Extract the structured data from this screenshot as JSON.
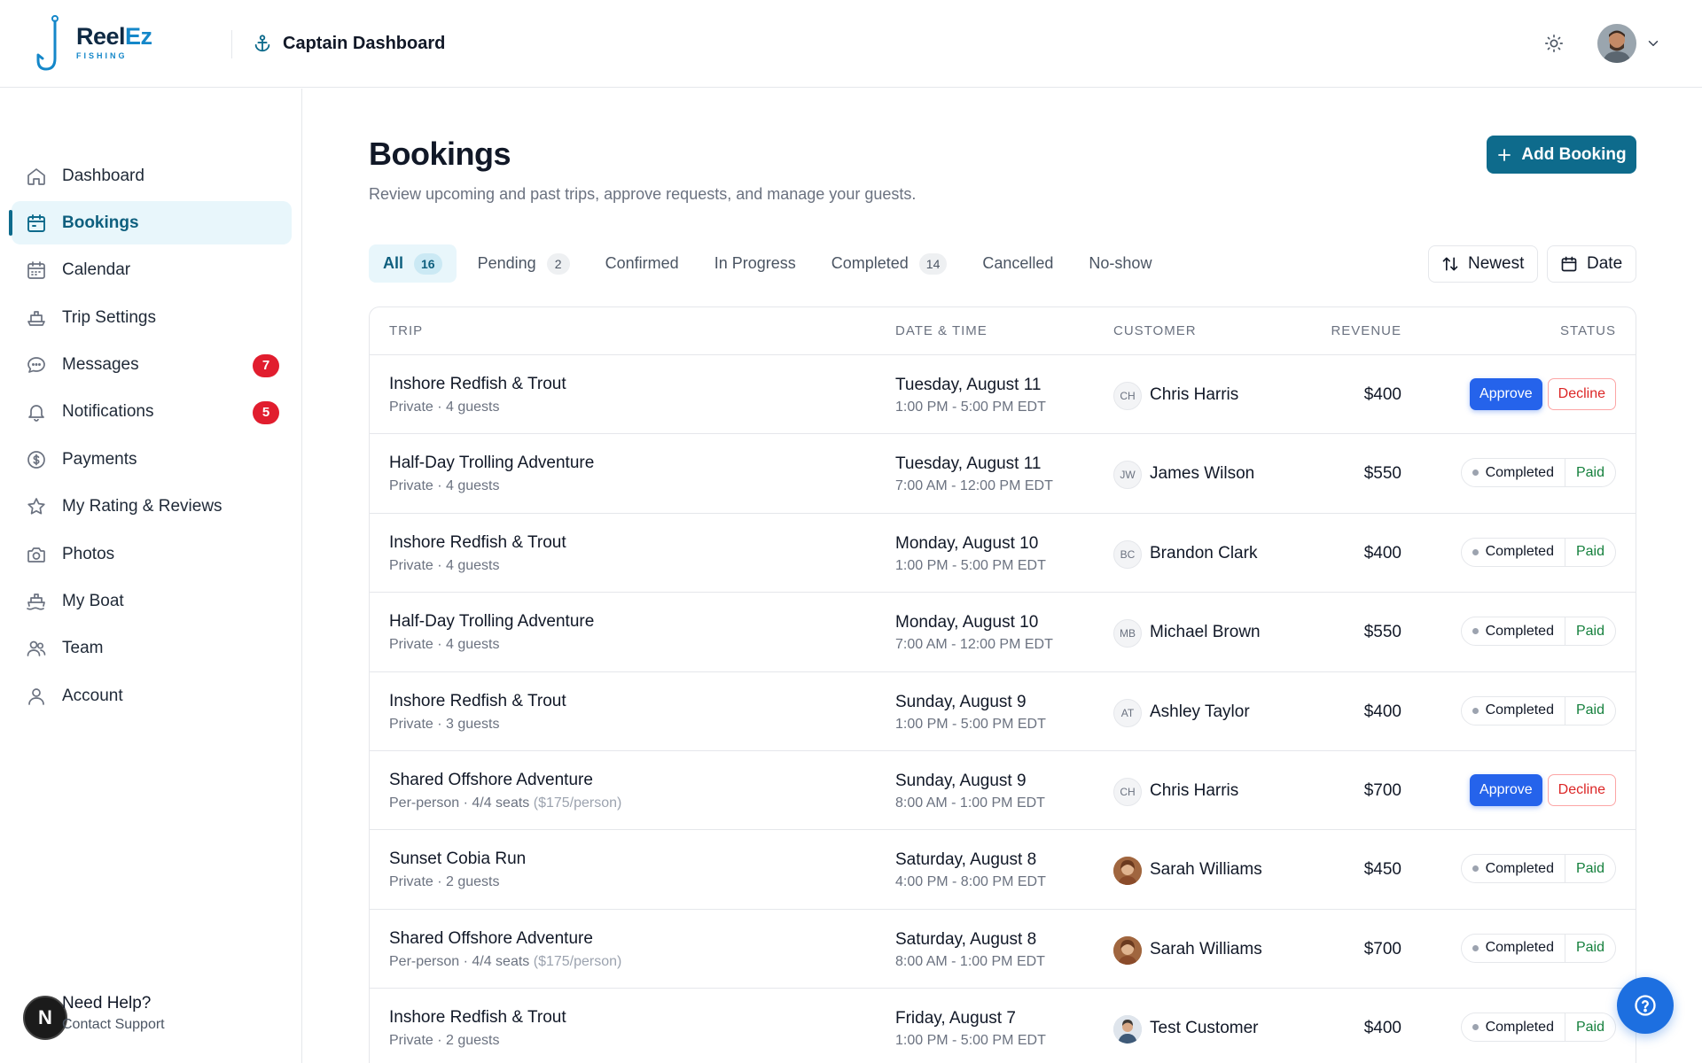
{
  "brand": {
    "word_1": "Reel",
    "word_2": "Ez",
    "tagline": "FISHING"
  },
  "header": {
    "title": "Captain Dashboard"
  },
  "sidebar": {
    "items": [
      {
        "label": "Dashboard",
        "icon": "home-icon"
      },
      {
        "label": "Bookings",
        "icon": "calendar-icon",
        "active": true
      },
      {
        "label": "Calendar",
        "icon": "calendar-grid-icon"
      },
      {
        "label": "Trip Settings",
        "icon": "boat-icon"
      },
      {
        "label": "Messages",
        "icon": "chat-icon",
        "badge": "7"
      },
      {
        "label": "Notifications",
        "icon": "bell-icon",
        "badge": "5"
      },
      {
        "label": "Payments",
        "icon": "dollar-icon"
      },
      {
        "label": "My Rating & Reviews",
        "icon": "star-icon"
      },
      {
        "label": "Photos",
        "icon": "camera-icon"
      },
      {
        "label": "My Boat",
        "icon": "ship-icon"
      },
      {
        "label": "Team",
        "icon": "team-icon"
      },
      {
        "label": "Account",
        "icon": "user-icon"
      }
    ],
    "help": {
      "avatar_letter": "N",
      "title": "Need Help?",
      "subtitle": "Contact Support"
    }
  },
  "page": {
    "title": "Bookings",
    "subtitle": "Review upcoming and past trips, approve requests, and manage your guests.",
    "add_label": "Add Booking"
  },
  "tabs": [
    {
      "label": "All",
      "count": "16",
      "active": true
    },
    {
      "label": "Pending",
      "count": "2"
    },
    {
      "label": "Confirmed"
    },
    {
      "label": "In Progress"
    },
    {
      "label": "Completed",
      "count": "14"
    },
    {
      "label": "Cancelled"
    },
    {
      "label": "No-show"
    }
  ],
  "toolbar": {
    "sort_label": "Newest",
    "date_label": "Date"
  },
  "table": {
    "headers": {
      "trip": "TRIP",
      "datetime": "DATE & TIME",
      "customer": "CUSTOMER",
      "revenue": "REVENUE",
      "status": "STATUS"
    },
    "approve_label": "Approve",
    "decline_label": "Decline",
    "rows": [
      {
        "trip": "Inshore Redfish & Trout",
        "meta": "Private · 4 guests",
        "date": "Tuesday, August 11",
        "time": "1:00 PM - 5:00 PM EDT",
        "initials": "CH",
        "customer": "Chris Harris",
        "revenue": "$400",
        "pending": true
      },
      {
        "trip": "Half-Day Trolling Adventure",
        "meta": "Private · 4 guests",
        "date": "Tuesday, August 11",
        "time": "7:00 AM - 12:00 PM EDT",
        "initials": "JW",
        "customer": "James Wilson",
        "revenue": "$550",
        "status": "Completed",
        "payment": "Paid"
      },
      {
        "trip": "Inshore Redfish & Trout",
        "meta": "Private · 4 guests",
        "date": "Monday, August 10",
        "time": "1:00 PM - 5:00 PM EDT",
        "initials": "BC",
        "customer": "Brandon Clark",
        "revenue": "$400",
        "status": "Completed",
        "payment": "Paid"
      },
      {
        "trip": "Half-Day Trolling Adventure",
        "meta": "Private · 4 guests",
        "date": "Monday, August 10",
        "time": "7:00 AM - 12:00 PM EDT",
        "initials": "MB",
        "customer": "Michael Brown",
        "revenue": "$550",
        "status": "Completed",
        "payment": "Paid"
      },
      {
        "trip": "Inshore Redfish & Trout",
        "meta": "Private · 3 guests",
        "date": "Sunday, August 9",
        "time": "1:00 PM - 5:00 PM EDT",
        "initials": "AT",
        "customer": "Ashley Taylor",
        "revenue": "$400",
        "status": "Completed",
        "payment": "Paid"
      },
      {
        "trip": "Shared Offshore Adventure",
        "meta": "Per-person · 4/4 seats",
        "meta_extra": "($175/person)",
        "date": "Sunday, August 9",
        "time": "8:00 AM - 1:00 PM EDT",
        "initials": "CH",
        "customer": "Chris Harris",
        "revenue": "$700",
        "pending": true
      },
      {
        "trip": "Sunset Cobia Run",
        "meta": "Private · 2 guests",
        "date": "Saturday, August 8",
        "time": "4:00 PM - 8:00 PM EDT",
        "photo": true,
        "customer": "Sarah Williams",
        "revenue": "$450",
        "status": "Completed",
        "payment": "Paid"
      },
      {
        "trip": "Shared Offshore Adventure",
        "meta": "Per-person · 4/4 seats",
        "meta_extra": "($175/person)",
        "date": "Saturday, August 8",
        "time": "8:00 AM - 1:00 PM EDT",
        "photo": true,
        "customer": "Sarah Williams",
        "revenue": "$700",
        "status": "Completed",
        "payment": "Paid"
      },
      {
        "trip": "Inshore Redfish & Trout",
        "meta": "Private · 2 guests",
        "date": "Friday, August 7",
        "time": "1:00 PM - 5:00 PM EDT",
        "photo": true,
        "photo_tone": "light",
        "customer": "Test Customer",
        "revenue": "$400",
        "status": "Completed",
        "payment": "Paid"
      }
    ]
  },
  "colors": {
    "primary": "#0e6b8c",
    "approve": "#2563eb",
    "decline": "#dc2626",
    "paid": "#15803d",
    "badge": "#e11d2e",
    "active_bg": "#e8f6fb"
  }
}
